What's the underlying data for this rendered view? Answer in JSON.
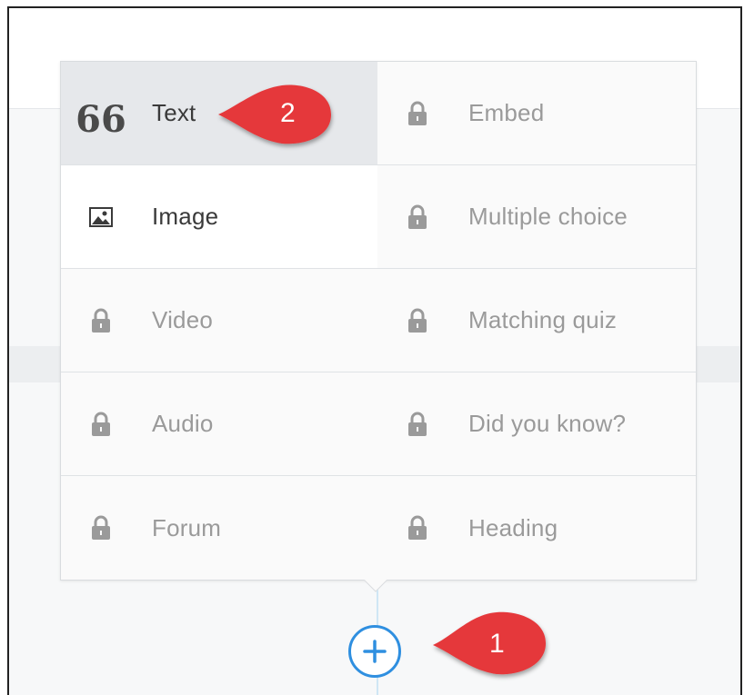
{
  "menu": {
    "items": [
      {
        "label": "Text",
        "icon": "quote-icon",
        "state": "active"
      },
      {
        "label": "Embed",
        "icon": "lock-icon",
        "state": "locked"
      },
      {
        "label": "Image",
        "icon": "image-icon",
        "state": "enabled"
      },
      {
        "label": "Multiple choice",
        "icon": "lock-icon",
        "state": "locked"
      },
      {
        "label": "Video",
        "icon": "lock-icon",
        "state": "locked"
      },
      {
        "label": "Matching quiz",
        "icon": "lock-icon",
        "state": "locked"
      },
      {
        "label": "Audio",
        "icon": "lock-icon",
        "state": "locked"
      },
      {
        "label": "Did you know?",
        "icon": "lock-icon",
        "state": "locked"
      },
      {
        "label": "Forum",
        "icon": "lock-icon",
        "state": "locked"
      },
      {
        "label": "Heading",
        "icon": "lock-icon",
        "state": "locked"
      }
    ],
    "quote_glyph": "66"
  },
  "add_button": {
    "icon": "plus-circle-icon"
  },
  "callouts": [
    {
      "number": "1"
    },
    {
      "number": "2"
    }
  ],
  "colors": {
    "accent": "#2f8fe0",
    "callout": "#e5383b",
    "locked_text": "#9a9a9a",
    "active_text": "#3a3a3a"
  }
}
